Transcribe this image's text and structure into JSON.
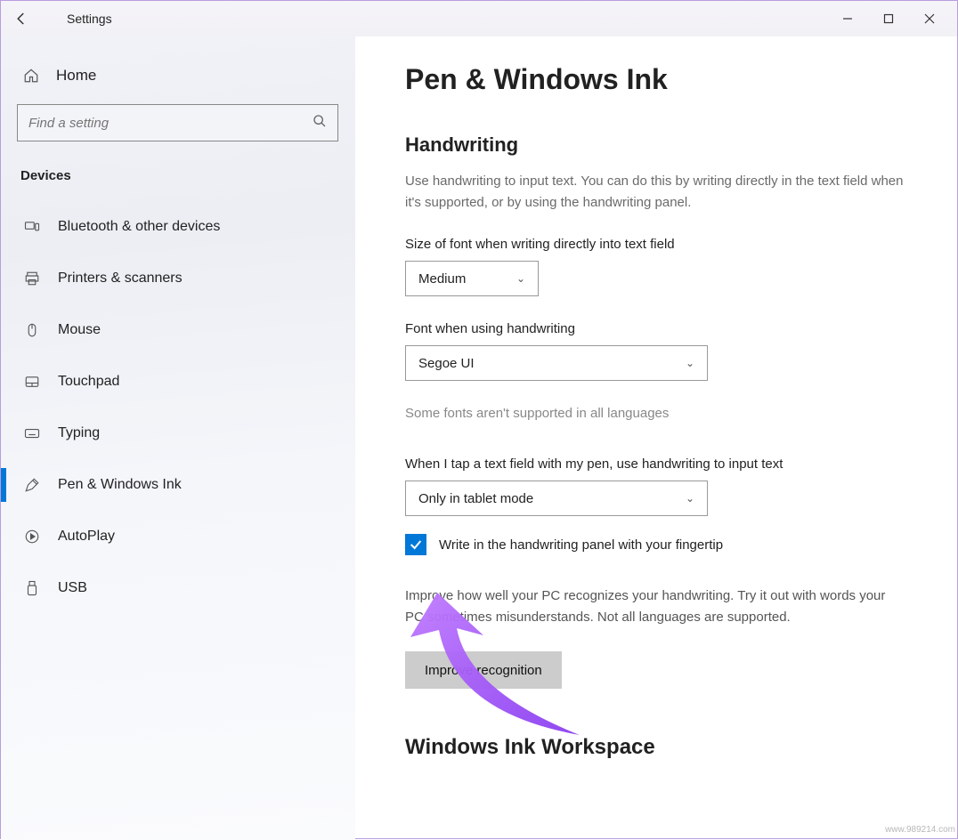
{
  "titlebar": {
    "title": "Settings"
  },
  "sidebar": {
    "home": "Home",
    "search_placeholder": "Find a setting",
    "category": "Devices",
    "items": [
      {
        "label": "Bluetooth & other devices"
      },
      {
        "label": "Printers & scanners"
      },
      {
        "label": "Mouse"
      },
      {
        "label": "Touchpad"
      },
      {
        "label": "Typing"
      },
      {
        "label": "Pen & Windows Ink"
      },
      {
        "label": "AutoPlay"
      },
      {
        "label": "USB"
      }
    ]
  },
  "page": {
    "title": "Pen & Windows Ink",
    "handwriting_heading": "Handwriting",
    "handwriting_desc": "Use handwriting to input text. You can do this by writing directly in the text field when it's supported, or by using the handwriting panel.",
    "font_size_label": "Size of font when writing directly into text field",
    "font_size_value": "Medium",
    "font_label": "Font when using handwriting",
    "font_value": "Segoe UI",
    "font_hint": "Some fonts aren't supported in all languages",
    "tap_label": "When I tap a text field with my pen, use handwriting to input text",
    "tap_value": "Only in tablet mode",
    "fingertip_checkbox": "Write in the handwriting panel with your fingertip",
    "improve_desc": "Improve how well your PC recognizes your handwriting. Try it out with words your PC sometimes misunderstands. Not all languages are supported.",
    "improve_button": "Improve recognition",
    "workspace_heading": "Windows Ink Workspace"
  },
  "watermark": "www.989214.com"
}
